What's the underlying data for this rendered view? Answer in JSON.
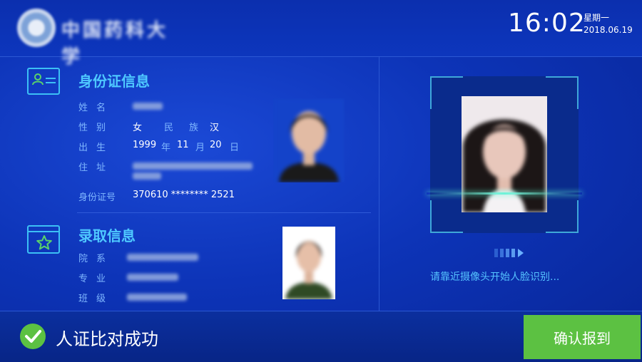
{
  "header": {
    "logo_text": "中国药科大学",
    "time": "16:02",
    "weekday": "星期一",
    "date": "2018.06.19"
  },
  "id_section": {
    "title": "身份证信息",
    "name_label": "姓名",
    "gender_label": "性别",
    "gender_value": "女",
    "ethnicity_label": "民族",
    "ethnicity_value": "汉",
    "birth_label": "出生",
    "birth_year": "1999",
    "birth_year_unit": "年",
    "birth_month": "11",
    "birth_month_unit": "月",
    "birth_day": "20",
    "birth_day_unit": "日",
    "address_label": "住址",
    "id_number_label": "身份证号",
    "id_number_value": "370610 ******** 2521"
  },
  "admission_section": {
    "title": "录取信息",
    "department_label": "院系",
    "major_label": "专业",
    "class_label": "班级"
  },
  "recognition": {
    "hint": "请靠近摄像头开始人脸识别..."
  },
  "footer": {
    "result_text": "人证比对成功",
    "confirm_label": "确认报到"
  },
  "colors": {
    "background": "#0d34b8",
    "accent_cyan": "#4ec8ff",
    "success_green": "#5cc142"
  }
}
